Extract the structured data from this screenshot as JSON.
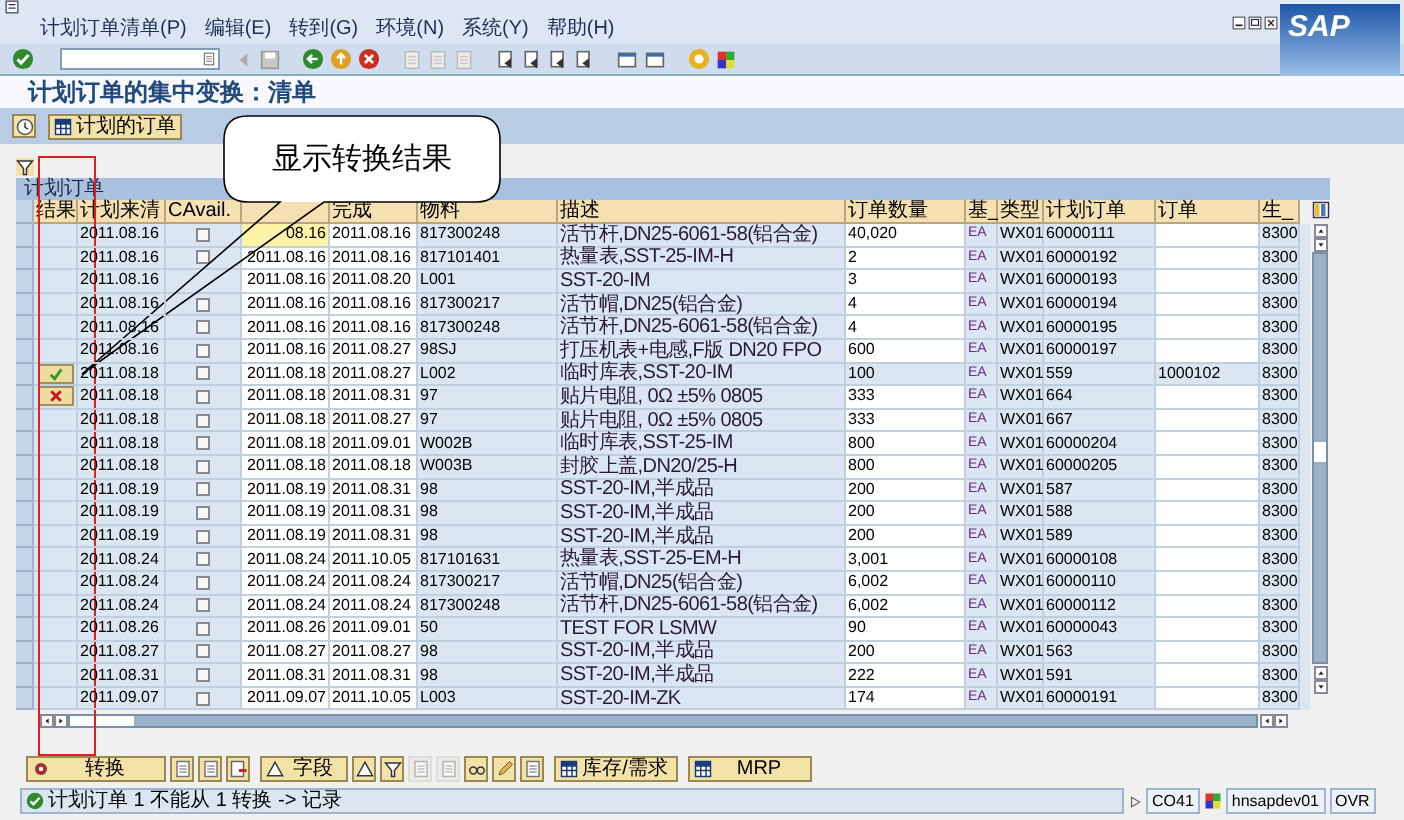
{
  "menu_bar": {
    "items": [
      "计划订单清单(P)",
      "编辑(E)",
      "转到(G)",
      "环境(N)",
      "系统(Y)",
      "帮助(H)"
    ]
  },
  "logo": "SAP",
  "page_title": "计划订单的集中变换：清单",
  "app_toolbar": {
    "buttons": [
      "计划的订单"
    ]
  },
  "table": {
    "title": "计划订单",
    "columns": [
      {
        "label": "结果",
        "kind": "result"
      },
      {
        "label": "计划来清",
        "kind": "plan_date"
      },
      {
        "label": "CAvail.",
        "kind": "cavail"
      },
      {
        "kind": "start"
      },
      {
        "label": "完成",
        "kind": "finish"
      },
      {
        "label": "物料",
        "kind": "material"
      },
      {
        "label": "描述",
        "kind": "description"
      },
      {
        "label": "订单数量",
        "kind": "quantity"
      },
      {
        "label": "基_",
        "kind": "unit"
      },
      {
        "label": "类型",
        "kind": "type"
      },
      {
        "label": "计划订单",
        "kind": "planned_order"
      },
      {
        "label": "订单",
        "kind": "order"
      },
      {
        "label": "生_",
        "kind": "plant"
      }
    ],
    "rows": [
      {
        "plan_date": "2011.08.16",
        "cavail": false,
        "start": "08.16",
        "finish": "2011.08.16",
        "material": "817300248",
        "description": "活节杆,DN25-6061-58(铝合金)",
        "quantity": "40,020",
        "unit": "EA",
        "type": "WX01",
        "planned_order": "60000111",
        "plant": "8300",
        "editable": true,
        "focused": true
      },
      {
        "plan_date": "2011.08.16",
        "cavail": false,
        "start": "2011.08.16",
        "finish": "2011.08.16",
        "material": "817101401",
        "description": "热量表,SST-25-IM-H",
        "quantity": "2",
        "unit": "EA",
        "type": "WX01",
        "planned_order": "60000192",
        "plant": "8300",
        "editable": true,
        "focused": false
      },
      {
        "plan_date": "2011.08.16",
        "start": "2011.08.16",
        "finish": "2011.08.20",
        "material": "L001",
        "description": "SST-20-IM",
        "quantity": "3",
        "unit": "EA",
        "type": "WX01",
        "planned_order": "60000193",
        "plant": "8300",
        "editable": true,
        "focused": false
      },
      {
        "plan_date": "2011.08.16",
        "cavail": false,
        "start": "2011.08.16",
        "finish": "2011.08.16",
        "material": "817300217",
        "description": "活节帽,DN25(铝合金)",
        "quantity": "4",
        "unit": "EA",
        "type": "WX01",
        "planned_order": "60000194",
        "plant": "8300",
        "editable": true,
        "focused": false
      },
      {
        "plan_date": "2011.08.16",
        "cavail": false,
        "start": "2011.08.16",
        "finish": "2011.08.16",
        "material": "817300248",
        "description": "活节杆,DN25-6061-58(铝合金)",
        "quantity": "4",
        "unit": "EA",
        "type": "WX01",
        "planned_order": "60000195",
        "plant": "8300",
        "editable": true,
        "focused": false
      },
      {
        "plan_date": "2011.08.16",
        "cavail": false,
        "start": "2011.08.16",
        "finish": "2011.08.27",
        "material": "98SJ",
        "description": "打压机表+电感,F版 DN20 FPO",
        "quantity": "600",
        "unit": "EA",
        "type": "WX01",
        "planned_order": "60000197",
        "plant": "8300",
        "editable": true,
        "focused": false
      },
      {
        "result": {
          "kind": "success"
        },
        "plan_date": "2011.08.18",
        "cavail": false,
        "start": "2011.08.18",
        "finish": "2011.08.27",
        "material": "L002",
        "description": "临时库表,SST-20-IM",
        "quantity": "100",
        "unit": "EA",
        "type": "WX01",
        "planned_order": "559",
        "order": "1000102",
        "plant": "8300",
        "editable": false,
        "focused": false
      },
      {
        "result": {
          "kind": "failure"
        },
        "plan_date": "2011.08.18",
        "cavail": false,
        "start": "2011.08.18",
        "finish": "2011.08.31",
        "material": "97",
        "description": "贴片电阻, 0Ω ±5% 0805",
        "quantity": "333",
        "unit": "EA",
        "type": "WX01",
        "planned_order": "664",
        "plant": "8300",
        "editable": true,
        "focused": false
      },
      {
        "plan_date": "2011.08.18",
        "cavail": false,
        "start": "2011.08.18",
        "finish": "2011.08.27",
        "material": "97",
        "description": "贴片电阻, 0Ω ±5% 0805",
        "quantity": "333",
        "unit": "EA",
        "type": "WX01",
        "planned_order": "667",
        "plant": "8300",
        "editable": true,
        "focused": false
      },
      {
        "plan_date": "2011.08.18",
        "cavail": false,
        "start": "2011.08.18",
        "finish": "2011.09.01",
        "material": "W002B",
        "description": "临时库表,SST-25-IM",
        "quantity": "800",
        "unit": "EA",
        "type": "WX01",
        "planned_order": "60000204",
        "plant": "8300",
        "editable": true,
        "focused": false
      },
      {
        "plan_date": "2011.08.18",
        "cavail": false,
        "start": "2011.08.18",
        "finish": "2011.08.18",
        "material": "W003B",
        "description": "封胶上盖,DN20/25-H",
        "quantity": "800",
        "unit": "EA",
        "type": "WX01",
        "planned_order": "60000205",
        "plant": "8300",
        "editable": true,
        "focused": false
      },
      {
        "plan_date": "2011.08.19",
        "cavail": false,
        "start": "2011.08.19",
        "finish": "2011.08.31",
        "material": "98",
        "description": "SST-20-IM,半成品",
        "quantity": "200",
        "unit": "EA",
        "type": "WX01",
        "planned_order": "587",
        "plant": "8300",
        "editable": true,
        "focused": false
      },
      {
        "plan_date": "2011.08.19",
        "cavail": false,
        "start": "2011.08.19",
        "finish": "2011.08.31",
        "material": "98",
        "description": "SST-20-IM,半成品",
        "quantity": "200",
        "unit": "EA",
        "type": "WX01",
        "planned_order": "588",
        "plant": "8300",
        "editable": true,
        "focused": false
      },
      {
        "plan_date": "2011.08.19",
        "cavail": false,
        "start": "2011.08.19",
        "finish": "2011.08.31",
        "material": "98",
        "description": "SST-20-IM,半成品",
        "quantity": "200",
        "unit": "EA",
        "type": "WX01",
        "planned_order": "589",
        "plant": "8300",
        "editable": true,
        "focused": false
      },
      {
        "plan_date": "2011.08.24",
        "cavail": false,
        "start": "2011.08.24",
        "finish": "2011.10.05",
        "material": "817101631",
        "description": "热量表,SST-25-EM-H",
        "quantity": "3,001",
        "unit": "EA",
        "type": "WX01",
        "planned_order": "60000108",
        "plant": "8300",
        "editable": true,
        "focused": false
      },
      {
        "plan_date": "2011.08.24",
        "cavail": false,
        "start": "2011.08.24",
        "finish": "2011.08.24",
        "material": "817300217",
        "description": "活节帽,DN25(铝合金)",
        "quantity": "6,002",
        "unit": "EA",
        "type": "WX01",
        "planned_order": "60000110",
        "plant": "8300",
        "editable": true,
        "focused": false
      },
      {
        "plan_date": "2011.08.24",
        "cavail": false,
        "start": "2011.08.24",
        "finish": "2011.08.24",
        "material": "817300248",
        "description": "活节杆,DN25-6061-58(铝合金)",
        "quantity": "6,002",
        "unit": "EA",
        "type": "WX01",
        "planned_order": "60000112",
        "plant": "8300",
        "editable": true,
        "focused": false
      },
      {
        "plan_date": "2011.08.26",
        "cavail": false,
        "start": "2011.08.26",
        "finish": "2011.09.01",
        "material": "50",
        "description": "TEST FOR LSMW",
        "quantity": "90",
        "unit": "EA",
        "type": "WX01",
        "planned_order": "60000043",
        "plant": "8300",
        "editable": true,
        "focused": false
      },
      {
        "plan_date": "2011.08.27",
        "cavail": false,
        "start": "2011.08.27",
        "finish": "2011.08.27",
        "material": "98",
        "description": "SST-20-IM,半成品",
        "quantity": "200",
        "unit": "EA",
        "type": "WX01",
        "planned_order": "563",
        "plant": "8300",
        "editable": true,
        "focused": false
      },
      {
        "plan_date": "2011.08.31",
        "cavail": false,
        "start": "2011.08.31",
        "finish": "2011.08.31",
        "material": "98",
        "description": "SST-20-IM,半成品",
        "quantity": "222",
        "unit": "EA",
        "type": "WX01",
        "planned_order": "591",
        "plant": "8300",
        "editable": true,
        "focused": false
      },
      {
        "plan_date": "2011.09.07",
        "cavail": false,
        "start": "2011.09.07",
        "finish": "2011.10.05",
        "material": "L003",
        "description": "SST-20-IM-ZK",
        "quantity": "174",
        "unit": "EA",
        "type": "WX01",
        "planned_order": "60000191",
        "plant": "8300",
        "editable": true,
        "focused": false
      }
    ]
  },
  "callout": "显示转换结果",
  "bottom_toolbar": {
    "buttons": [
      {
        "kind": "text",
        "label": "转换"
      },
      {
        "kind": "icon",
        "disabled": false
      },
      {
        "kind": "icon",
        "disabled": false
      },
      {
        "kind": "icon",
        "disabled": false
      },
      {
        "kind": "text",
        "label": "字段"
      },
      {
        "kind": "icon",
        "disabled": false
      },
      {
        "kind": "icon",
        "disabled": false
      },
      {
        "kind": "icon",
        "disabled": true
      },
      {
        "kind": "icon",
        "disabled": true
      },
      {
        "kind": "icon",
        "disabled": false
      },
      {
        "kind": "icon",
        "disabled": false
      },
      {
        "kind": "icon",
        "disabled": false
      },
      {
        "kind": "text",
        "label": "库存/需求"
      },
      {
        "kind": "text",
        "label": "MRP"
      }
    ]
  },
  "status_bar": {
    "message": "计划订单 1 不能从 1 转换 -> 记录",
    "transaction": "CO41",
    "server": "hnsapdev01",
    "mode": "OVR"
  }
}
